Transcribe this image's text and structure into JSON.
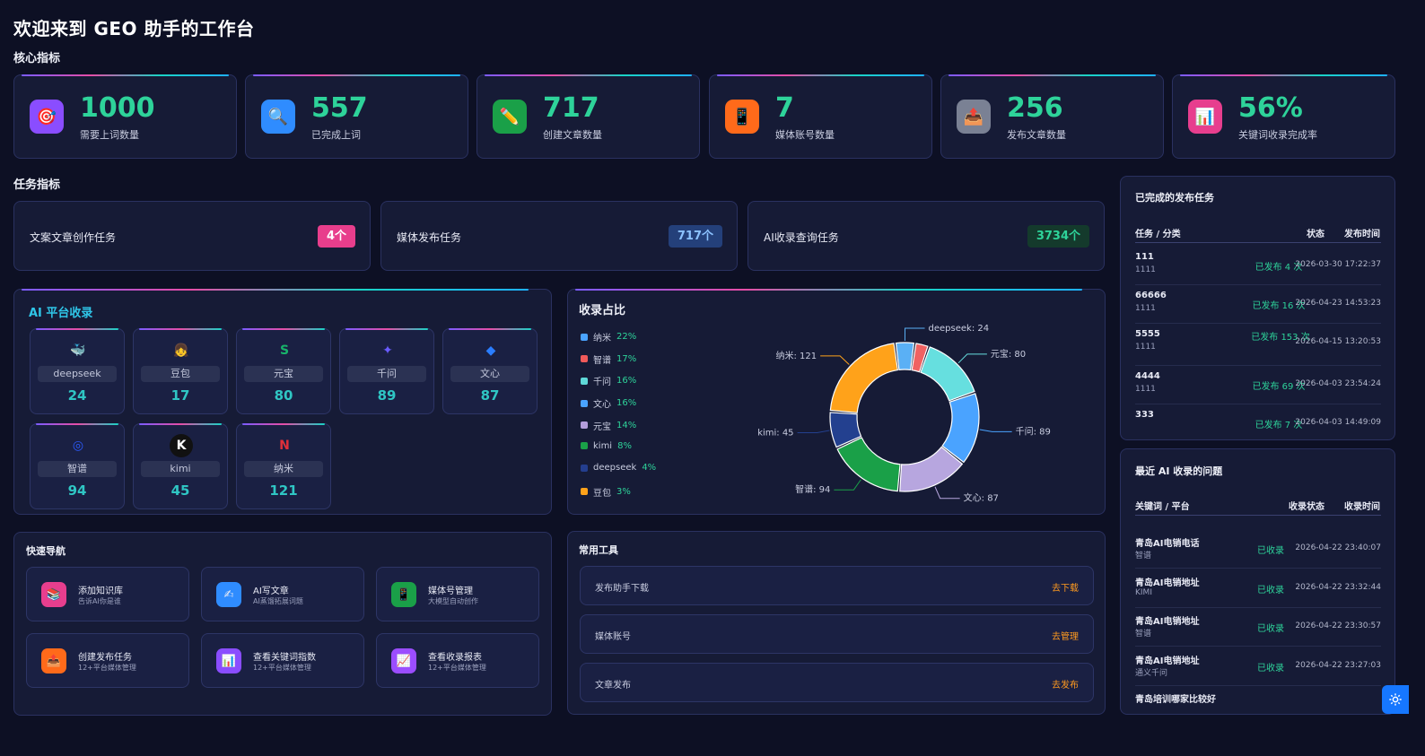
{
  "title": "欢迎来到 GEO 助手的工作台",
  "core": {
    "title": "核心指标",
    "items": [
      {
        "value": "1000",
        "label": "需要上词数量",
        "icon": "target-icon",
        "glyph": "🎯",
        "color": "#8a4dff"
      },
      {
        "value": "557",
        "label": "已完成上词",
        "icon": "magnifier-icon",
        "glyph": "🔍",
        "color": "#2f8cff"
      },
      {
        "value": "717",
        "label": "创建文章数量",
        "icon": "pencil-icon",
        "glyph": "✏️",
        "color": "#1aa048"
      },
      {
        "value": "7",
        "label": "媒体账号数量",
        "icon": "phone-icon",
        "glyph": "📱",
        "color": "#ff6a1a"
      },
      {
        "value": "256",
        "label": "发布文章数量",
        "icon": "upload-tray-icon",
        "glyph": "📤",
        "color": "#7a8194"
      },
      {
        "value": "56%",
        "label": "关键词收录完成率",
        "icon": "bar-chart-icon",
        "glyph": "📊",
        "color": "#e73e8e"
      }
    ]
  },
  "tasks": {
    "title": "任务指标",
    "items": [
      {
        "label": "文案文章创作任务",
        "badge": "4个",
        "bg": "#e83e8c",
        "fg": "#ffffff"
      },
      {
        "label": "媒体发布任务",
        "badge": "717个",
        "bg": "#24407a",
        "fg": "#8cc2ff"
      },
      {
        "label": "AI收录查询任务",
        "badge": "3734个",
        "bg": "#143a2c",
        "fg": "#2ed39a"
      }
    ]
  },
  "platforms": {
    "title": "AI 平台收录",
    "items": [
      {
        "name": "deepseek",
        "value": "24",
        "icon": "deepseek-whale-icon",
        "glyph": "🐳",
        "color": "#4d6bfe"
      },
      {
        "name": "豆包",
        "value": "17",
        "icon": "doubao-avatar-icon",
        "glyph": "👧",
        "color": "#f2c9a0"
      },
      {
        "name": "元宝",
        "value": "80",
        "icon": "yuanbao-icon",
        "glyph": "S",
        "color": "#18b36b"
      },
      {
        "name": "千问",
        "value": "89",
        "icon": "qianwen-icon",
        "glyph": "✦",
        "color": "#6a5cff"
      },
      {
        "name": "文心",
        "value": "87",
        "icon": "wenxin-icon",
        "glyph": "◆",
        "color": "#2a7dff"
      },
      {
        "name": "智谱",
        "value": "94",
        "icon": "zhipu-icon",
        "glyph": "◎",
        "color": "#2b5bff"
      },
      {
        "name": "kimi",
        "value": "45",
        "icon": "kimi-icon",
        "glyph": "K",
        "color": "#111111"
      },
      {
        "name": "纳米",
        "value": "121",
        "icon": "nami-icon",
        "glyph": "N",
        "color": "#e0303a"
      }
    ]
  },
  "share": {
    "title": "收录占比",
    "legend": [
      {
        "name": "纳米",
        "pct": "22%",
        "color": "#4aa3ff"
      },
      {
        "name": "智谱",
        "pct": "17%",
        "color": "#f05a5a"
      },
      {
        "name": "千问",
        "pct": "16%",
        "color": "#5fd8d8"
      },
      {
        "name": "文心",
        "pct": "16%",
        "color": "#4aa3ff"
      },
      {
        "name": "元宝",
        "pct": "14%",
        "color": "#b39ddb"
      },
      {
        "name": "kimi",
        "pct": "8%",
        "color": "#1aa048"
      },
      {
        "name": "deepseek",
        "pct": "4%",
        "color": "#243e8e"
      },
      {
        "name": "豆包",
        "pct": "3%",
        "color": "#ffa21a"
      }
    ]
  },
  "chart_data": {
    "type": "pie",
    "title": "收录占比",
    "slices": [
      {
        "name": "deepseek",
        "value": 24,
        "color": "#5ab0f5"
      },
      {
        "name": "豆包",
        "value": 17,
        "color": "#f06262"
      },
      {
        "name": "元宝",
        "value": 80,
        "color": "#66dfdf"
      },
      {
        "name": "千问",
        "value": 89,
        "color": "#4aa3ff"
      },
      {
        "name": "文心",
        "value": 87,
        "color": "#b7a6df"
      },
      {
        "name": "智谱",
        "value": 94,
        "color": "#1aa048"
      },
      {
        "name": "kimi",
        "value": 45,
        "color": "#23408f"
      },
      {
        "name": "纳米",
        "value": 121,
        "color": "#ffa21a"
      }
    ],
    "labels": [
      "deepseek: 24",
      "元宝: 80",
      "千问: 89",
      "文心: 87",
      "智谱: 94",
      "kimi: 45",
      "纳米: 121"
    ]
  },
  "quicknav": {
    "title": "快速导航",
    "items": [
      {
        "title": "添加知识库",
        "sub": "告诉AI你是谁",
        "icon": "book-icon",
        "glyph": "📚",
        "color": "#e73e8e"
      },
      {
        "title": "AI写文章",
        "sub": "AI蒸馏拓展词题",
        "icon": "write-icon",
        "glyph": "✍",
        "color": "#2f8cff"
      },
      {
        "title": "媒体号管理",
        "sub": "大模型自动创作",
        "icon": "phone-icon",
        "glyph": "📱",
        "color": "#1aa048"
      },
      {
        "title": "创建发布任务",
        "sub": "12+平台媒体管理",
        "icon": "upload-tray-icon",
        "glyph": "📤",
        "color": "#ff6a1a"
      },
      {
        "title": "查看关键词指数",
        "sub": "12+平台媒体管理",
        "icon": "bar-chart-icon",
        "glyph": "📊",
        "color": "#8a4dff"
      },
      {
        "title": "查看收录报表",
        "sub": "12+平台媒体管理",
        "icon": "line-chart-icon",
        "glyph": "📈",
        "color": "#9b4dff"
      }
    ]
  },
  "tools": {
    "title": "常用工具",
    "items": [
      {
        "label": "发布助手下载",
        "action": "去下载"
      },
      {
        "label": "媒体账号",
        "action": "去管理"
      },
      {
        "label": "文章发布",
        "action": "去发布"
      }
    ]
  },
  "published": {
    "title": "已完成的发布任务",
    "headers": {
      "name": "任务 / 分类",
      "status": "状态",
      "time": "发布时间"
    },
    "rows": [
      {
        "name": "111",
        "sub": "1111",
        "status": "已发布 4 次",
        "time": "2026-03-30 17:22:37"
      },
      {
        "name": "66666",
        "sub": "1111",
        "status": "已发布 16 次",
        "time": "2026-04-23 14:53:23"
      },
      {
        "name": "5555",
        "sub": "1111",
        "status": "已发布 153 次",
        "time": "2026-04-15 13:20:53"
      },
      {
        "name": "4444",
        "sub": "1111",
        "status": "已发布 69 次",
        "time": "2026-04-03 23:54:24"
      },
      {
        "name": "333",
        "sub": "",
        "status": "已发布 7 次",
        "time": "2026-04-03 14:49:09"
      }
    ]
  },
  "recent": {
    "title": "最近 AI 收录的问题",
    "headers": {
      "name": "关键词 / 平台",
      "status": "收录状态",
      "time": "收录时间"
    },
    "rows": [
      {
        "name": "青岛AI电销电话",
        "sub": "智谱",
        "status": "已收录",
        "time": "2026-04-22 23:40:07"
      },
      {
        "name": "青岛AI电销地址",
        "sub": "KIMI",
        "status": "已收录",
        "time": "2026-04-22 23:32:44"
      },
      {
        "name": "青岛AI电销地址",
        "sub": "智谱",
        "status": "已收录",
        "time": "2026-04-22 23:30:57"
      },
      {
        "name": "青岛AI电销地址",
        "sub": "通义千问",
        "status": "已收录",
        "time": "2026-04-22 23:27:03"
      },
      {
        "name": "青岛培训哪家比较好",
        "sub": "",
        "status": "",
        "time": ""
      }
    ]
  },
  "settings_icon": "gear-icon"
}
